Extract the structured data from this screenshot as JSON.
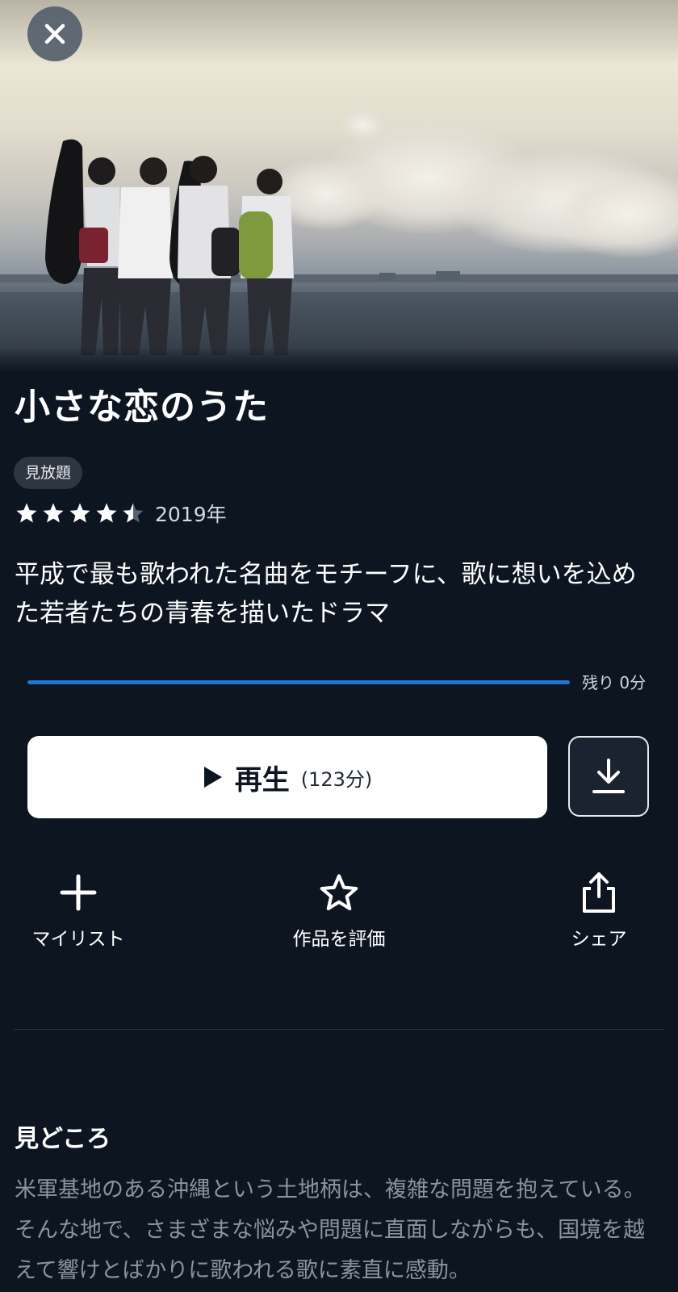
{
  "hero": {
    "image_description": "Four students with guitars standing by the sea at dusk"
  },
  "close_button": {
    "icon": "close-icon"
  },
  "title": "小さな恋のうた",
  "badge": "見放題",
  "rating": {
    "value": 4.5,
    "max": 5,
    "year": "2019年"
  },
  "synopsis": "平成で最も歌われた名曲をモチーフに、歌に想いを込めた若者たちの青春を描いたドラマ",
  "progress": {
    "fraction": 1.0,
    "remaining_label": "残り 0分",
    "color": "#1f76d2"
  },
  "play": {
    "label": "再生",
    "duration": "(123分)",
    "icon": "play-icon"
  },
  "download": {
    "icon": "download-icon"
  },
  "actions": [
    {
      "label": "マイリスト",
      "icon": "plus-icon"
    },
    {
      "label": "作品を評価",
      "icon": "star-outline-icon"
    },
    {
      "label": "シェア",
      "icon": "share-icon"
    }
  ],
  "highlights": {
    "title": "見どころ",
    "body": "米軍基地のある沖縄という土地柄は、複雑な問題を抱えている。そんな地で、さまざまな悩みや問題に直面しながらも、国境を越えて響けとばかりに歌われる歌に素直に感動。"
  },
  "colors": {
    "background": "#0d1520",
    "accent": "#1f76d2",
    "muted_text": "#8b939e"
  }
}
